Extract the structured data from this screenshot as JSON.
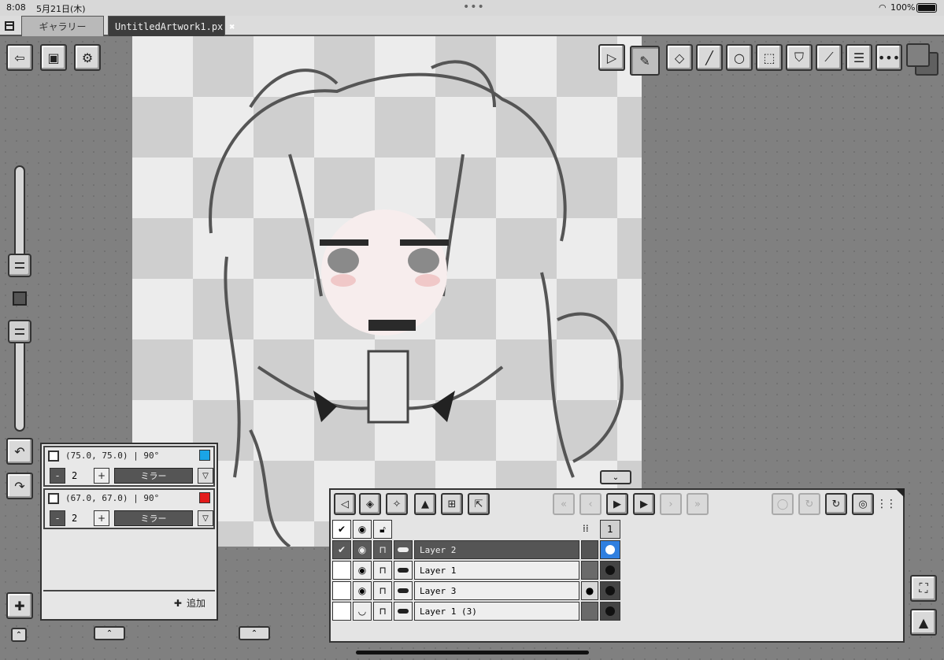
{
  "status_bar": {
    "time": "8:08",
    "date": "5月21日(木)",
    "battery": "100%"
  },
  "tabs": [
    {
      "label": "ギャラリー",
      "active": false
    },
    {
      "label": "UntitledArtwork1.px",
      "active": true
    }
  ],
  "top_left_tools": [
    "back-icon",
    "export-icon",
    "settings-icon"
  ],
  "toolbar": {
    "tools": [
      "select-icon",
      "pencil-icon",
      "eraser-icon",
      "line-icon",
      "circle-icon",
      "rect-select-icon",
      "fill-icon",
      "eyedropper-icon",
      "adjust-icon",
      "more-icon"
    ],
    "active_tool": "pencil-icon",
    "primary_color": "#808080",
    "secondary_color": "#606060"
  },
  "mirror_panel": {
    "rows": [
      {
        "coord": "(75.0, 75.0) | 90°",
        "count": "2",
        "mode": "ミラー",
        "color": "#1aa5e6"
      },
      {
        "coord": "(67.0, 67.0) | 90°",
        "count": "2",
        "mode": "ミラー",
        "color": "#e31b1b"
      }
    ],
    "add_label": "追加"
  },
  "layer_panel": {
    "frame_number": "1",
    "layers": [
      {
        "name": "Layer 2",
        "checked": true,
        "visible": true,
        "selected": true
      },
      {
        "name": "Layer 1",
        "checked": false,
        "visible": true,
        "selected": false
      },
      {
        "name": "Layer 3",
        "checked": false,
        "visible": true,
        "selected": false
      },
      {
        "name": "Layer 1 (3)",
        "checked": false,
        "visible": false,
        "selected": false
      }
    ]
  }
}
